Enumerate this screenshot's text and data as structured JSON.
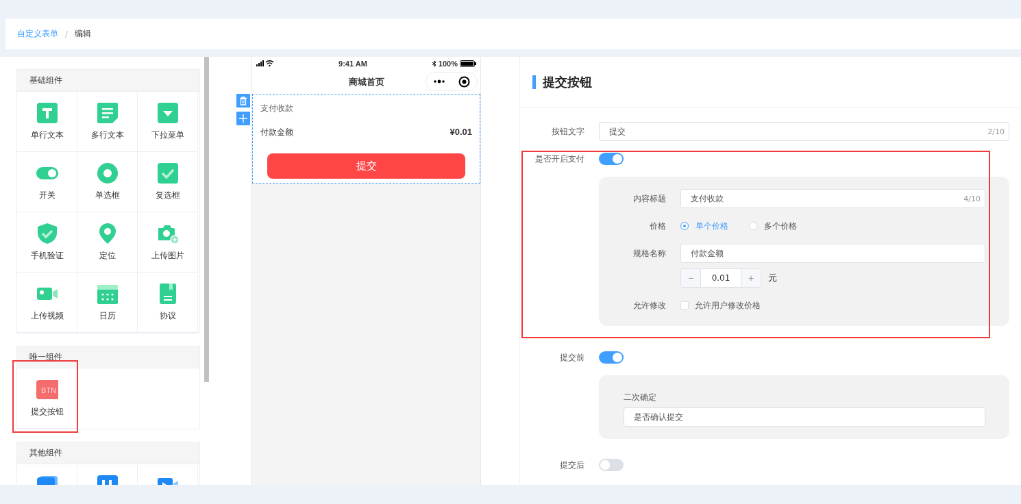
{
  "breadcrumb": {
    "items": [
      {
        "label": "自定义表单",
        "link": true
      },
      {
        "label": "编辑",
        "link": false
      }
    ],
    "separator": "/"
  },
  "palette": {
    "sections": [
      {
        "title": "基础组件",
        "items": [
          {
            "label": "单行文本"
          },
          {
            "label": "多行文本"
          },
          {
            "label": "下拉菜单"
          },
          {
            "label": "开关"
          },
          {
            "label": "单选框"
          },
          {
            "label": "复选框"
          },
          {
            "label": "手机验证"
          },
          {
            "label": "定位"
          },
          {
            "label": "上传图片"
          },
          {
            "label": "上传视频"
          },
          {
            "label": "日历"
          },
          {
            "label": "协议"
          }
        ]
      },
      {
        "title": "唯一组件",
        "items": [
          {
            "label": "提交按钮",
            "badge": "BTN"
          }
        ]
      },
      {
        "title": "其他组件"
      }
    ]
  },
  "phone": {
    "status_bar": {
      "time": "9:41 AM",
      "battery": "100%"
    },
    "title": "商城首页",
    "form": {
      "title": "支付收款",
      "amount_label": "付款金额",
      "amount": "¥0.01",
      "submit": "提交"
    }
  },
  "editor": {
    "title": "提交按钮",
    "button_text": {
      "label": "按钮文字",
      "value": "提交",
      "count": "2/10"
    },
    "payment": {
      "label": "是否开启支付",
      "on": true,
      "title": {
        "label": "内容标题",
        "value": "支付收款",
        "count": "4/10"
      },
      "price": {
        "label": "价格",
        "options": [
          {
            "label": "单个价格",
            "selected": true
          },
          {
            "label": "多个价格",
            "selected": false
          }
        ]
      },
      "spec": {
        "label": "规格名称",
        "value": "付款金额",
        "amount": "0.01",
        "minus": "−",
        "plus": "+",
        "unit": "元"
      },
      "allow_edit": {
        "label": "允许修改",
        "option": "允许用户修改价格",
        "checked": false
      }
    },
    "before_submit": {
      "label": "提交前",
      "on": true,
      "confirm_label": "二次确定",
      "confirm_value": "是否确认提交"
    },
    "after_submit": {
      "label": "提交后",
      "on": false
    }
  }
}
